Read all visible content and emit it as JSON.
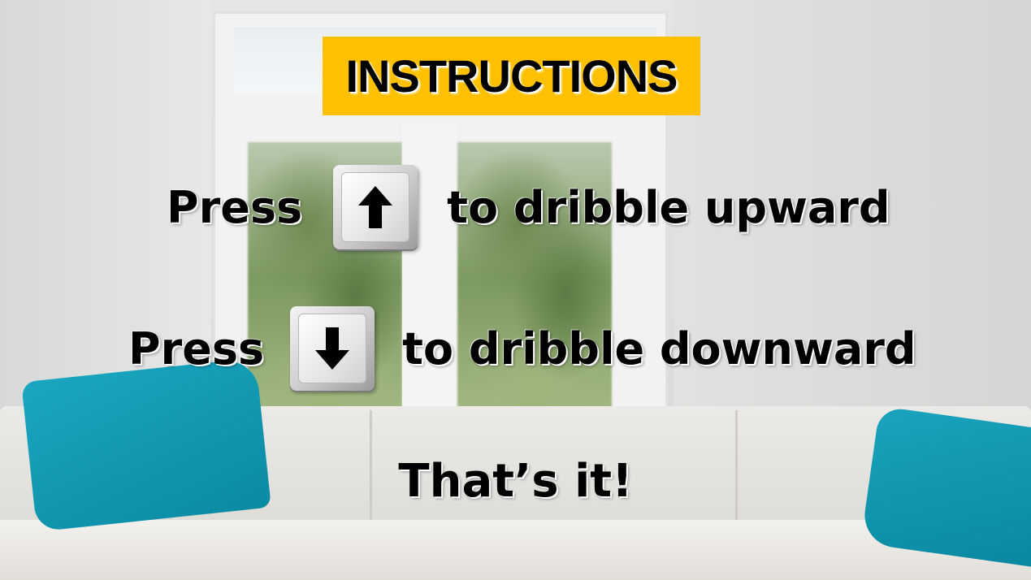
{
  "title": "INSTRUCTIONS",
  "instructions": [
    {
      "prefix": "Press",
      "key_icon": "arrow-up-key-icon",
      "action": "to dribble upward"
    },
    {
      "prefix": "Press",
      "key_icon": "arrow-down-key-icon",
      "action": "to dribble downward"
    }
  ],
  "closing": "That’s it!",
  "colors": {
    "title_bg": "#ffc000",
    "text": "#000000",
    "pillow": "#0b9ab4"
  }
}
